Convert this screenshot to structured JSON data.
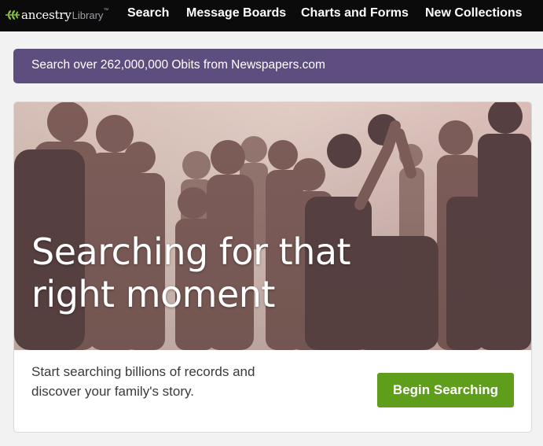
{
  "header": {
    "logo": {
      "wordmark": "ancestry",
      "sub": "Library",
      "tm": "™"
    },
    "nav": [
      {
        "label": "Search"
      },
      {
        "label": "Message Boards"
      },
      {
        "label": "Charts and Forms"
      },
      {
        "label": "New Collections"
      }
    ]
  },
  "promo": {
    "text": "Search over 262,000,000 Obits from Newspapers.com"
  },
  "hero": {
    "headline": "Searching for that right moment",
    "description": "Start searching billions of records and discover your family's story.",
    "cta_label": "Begin Searching"
  },
  "colors": {
    "topbar": "#0b0b0b",
    "promo_banner": "#5e4e80",
    "cta_green": "#5f9e1b",
    "logo_leaf": "#8cc63f"
  },
  "icons": {
    "logo": "ancestry-leaf-icon"
  }
}
